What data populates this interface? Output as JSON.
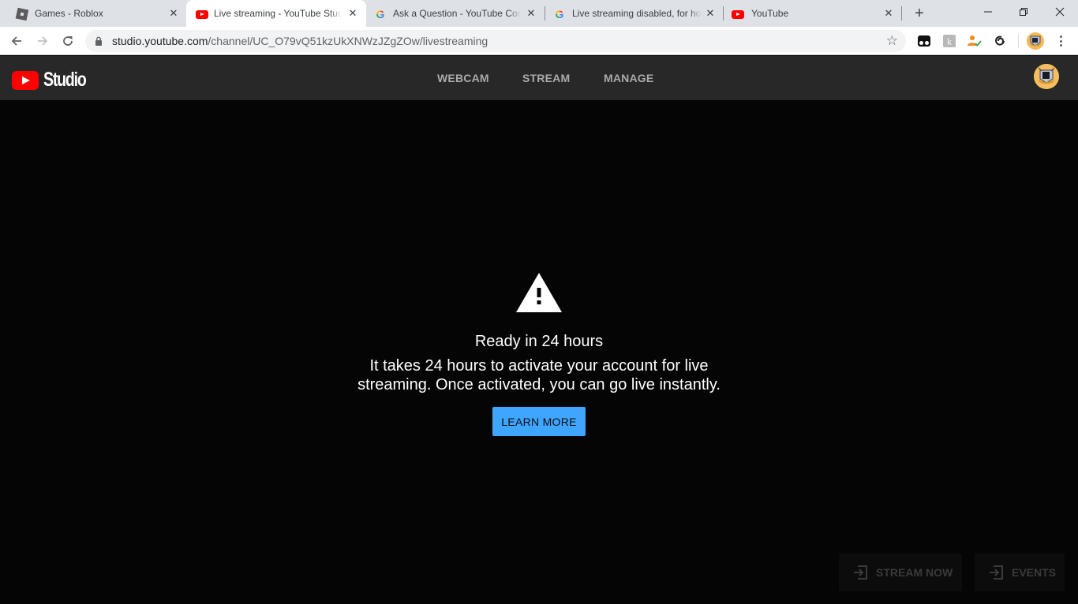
{
  "browser": {
    "tabs": [
      {
        "title": "Games - Roblox",
        "favicon": "roblox-icon",
        "active": false
      },
      {
        "title": "Live streaming - YouTube Studio",
        "favicon": "youtube-icon",
        "active": true
      },
      {
        "title": "Ask a Question - YouTube Community",
        "favicon": "google-icon",
        "active": false
      },
      {
        "title": "Live streaming disabled, for how long",
        "favicon": "google-icon",
        "active": false
      },
      {
        "title": "YouTube",
        "favicon": "youtube-icon",
        "active": false
      }
    ],
    "close_glyph": "✕",
    "new_tab_glyph": "+",
    "window_controls": {
      "minimize": "minimize-icon",
      "restore": "restore-icon",
      "close": "close-icon"
    },
    "address": {
      "host": "studio.youtube.com",
      "path": "/channel/UC_O79vQ51kzUkXNWzJZgZOw/livestreaming"
    },
    "bookmark_glyph": "☆",
    "extensions": [
      "tampermonkey-icon",
      "k-extension-icon",
      "user-check-icon",
      "link-loop-icon"
    ]
  },
  "studio": {
    "logo_text": "Studio",
    "nav": [
      {
        "label": "WEBCAM"
      },
      {
        "label": "STREAM"
      },
      {
        "label": "MANAGE"
      }
    ]
  },
  "notice": {
    "icon": "warning-icon",
    "headline": "Ready in 24 hours",
    "body": "It takes 24 hours to activate your account for live streaming. Once activated, you can go live instantly.",
    "button_label": "LEARN MORE",
    "button_color": "#3ea6ff"
  },
  "footer_actions": [
    {
      "label": "STREAM NOW",
      "icon": "enter-icon",
      "enabled": false
    },
    {
      "label": "EVENTS",
      "icon": "enter-icon",
      "enabled": false
    }
  ],
  "colors": {
    "youtube_red": "#ff0000",
    "header_bg": "#282828",
    "page_bg": "#050505",
    "nav_text": "#aaaaaa"
  }
}
